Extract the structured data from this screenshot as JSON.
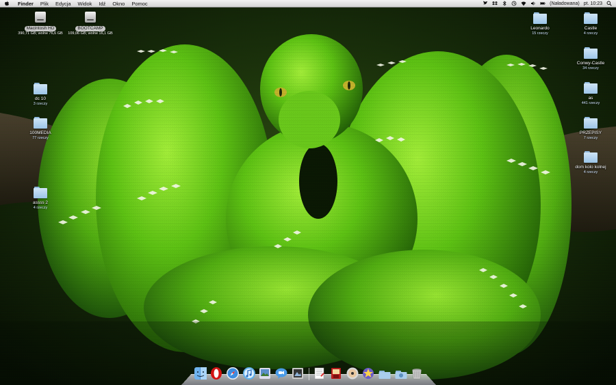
{
  "menubar": {
    "app_name": "Finder",
    "menus": [
      "Plik",
      "Edycja",
      "Widok",
      "Idź",
      "Okno",
      "Pomoc"
    ],
    "battery_status": "(Naładowana)",
    "clock": "pt. 10:23"
  },
  "desktop": {
    "drives": [
      {
        "name": "Macintosh HD",
        "info": "390,71 GB; wolne 76,6 GB"
      },
      {
        "name": "BOOTCAMP",
        "info": "109,06 GB; wolne 16,1 GB"
      }
    ],
    "folders_left": [
      {
        "name": "dc  10",
        "info": "3 rzeczy"
      },
      {
        "name": "100MEDIA",
        "info": "77 rzeczy"
      },
      {
        "name": "assss 2",
        "info": "4 rzeczy"
      }
    ],
    "folders_right": [
      {
        "name": "Leonardo",
        "info": "15 rzeczy"
      },
      {
        "name": "Castle",
        "info": "4 rzeczy"
      },
      {
        "name": "Conwy-Castle",
        "info": "34 rzeczy"
      },
      {
        "name": "as",
        "info": "441 rzeczy"
      },
      {
        "name": "PRZEPISY",
        "info": "7 rzeczy"
      },
      {
        "name": "dom kolo kolnej",
        "info": "4 rzeczy"
      }
    ]
  },
  "dock": {
    "apps": [
      "finder-icon",
      "opera-icon",
      "safari-icon",
      "itunes-icon",
      "iphoto-icon",
      "ichat-icon",
      "preview-icon"
    ],
    "others": [
      "textedit-icon",
      "photobooth-icon",
      "dvd-player-icon",
      "frontrow-icon",
      "applications-stack-icon",
      "downloads-stack-icon",
      "trash-icon"
    ]
  },
  "colors": {
    "menubar": "#e6e6e6",
    "folder": "#a9cdec",
    "snake_green": "#6fd419",
    "background_dark": "#0d1a06"
  }
}
